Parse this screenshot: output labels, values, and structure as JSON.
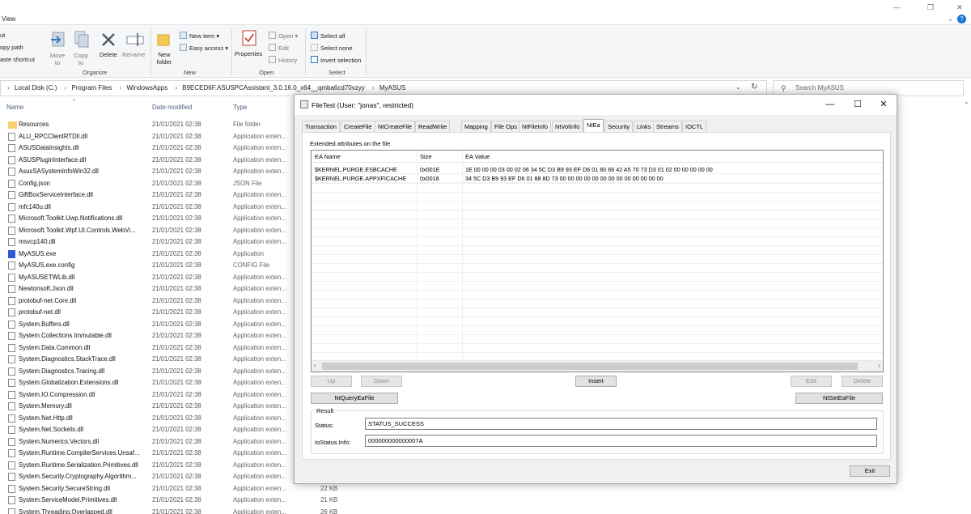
{
  "explorer": {
    "menu_view": "View",
    "ribbon": {
      "cut": "ut",
      "copy_path": "opy path",
      "paste_shortcut": "aste shortcut",
      "move_to": "Move to",
      "copy_to": "Copy to",
      "delete": "Delete",
      "rename": "Rename",
      "new_folder": "New folder",
      "new_item": "New item",
      "easy_access": "Easy access",
      "properties": "Properties",
      "open": "Open",
      "edit": "Edit",
      "history": "History",
      "select_all": "Select all",
      "select_none": "Select none",
      "invert_selection": "Invert selection",
      "groups": {
        "organize": "Organize",
        "new": "New",
        "open": "Open",
        "select": "Select"
      }
    },
    "address": [
      "Local Disk (C:)",
      "Program Files",
      "WindowsApps",
      "B9ECED6F.ASUSPCAssistant_3.0.16.0_x64__qmba6cd70vzyy",
      "MyASUS"
    ],
    "search_placeholder": "Search MyASUS",
    "columns": {
      "name": "Name",
      "date": "Date modified",
      "type": "Type"
    },
    "files": [
      {
        "name": "Resources",
        "date": "21/01/2021 02:38",
        "type": "File folder",
        "icon": "folder"
      },
      {
        "name": "ALU_RPCClientRTDll.dll",
        "date": "21/01/2021 02:38",
        "type": "Application exten...",
        "icon": "file"
      },
      {
        "name": "ASUSDataInsights.dll",
        "date": "21/01/2021 02:38",
        "type": "Application exten...",
        "icon": "file"
      },
      {
        "name": "ASUSPluginInterface.dll",
        "date": "21/01/2021 02:38",
        "type": "Application exten...",
        "icon": "file"
      },
      {
        "name": "AsusSASystemInfoWin32.dll",
        "date": "21/01/2021 02:38",
        "type": "Application exten...",
        "icon": "file"
      },
      {
        "name": "Config.json",
        "date": "21/01/2021 02:38",
        "type": "JSON File",
        "icon": "file"
      },
      {
        "name": "GiftBoxServiceInterface.dll",
        "date": "21/01/2021 02:38",
        "type": "Application exten...",
        "icon": "file"
      },
      {
        "name": "mfc140u.dll",
        "date": "21/01/2021 02:38",
        "type": "Application exten...",
        "icon": "file"
      },
      {
        "name": "Microsoft.Toolkit.Uwp.Notifications.dll",
        "date": "21/01/2021 02:38",
        "type": "Application exten...",
        "icon": "file"
      },
      {
        "name": "Microsoft.Toolkit.Wpf.UI.Controls.WebVi...",
        "date": "21/01/2021 02:38",
        "type": "Application exten...",
        "icon": "file"
      },
      {
        "name": "msvcp140.dll",
        "date": "21/01/2021 02:38",
        "type": "Application exten...",
        "icon": "file"
      },
      {
        "name": "MyASUS.exe",
        "date": "21/01/2021 02:38",
        "type": "Application",
        "icon": "exe"
      },
      {
        "name": "MyASUS.exe.config",
        "date": "21/01/2021 02:38",
        "type": "CONFIG File",
        "icon": "file"
      },
      {
        "name": "MyASUSETWLib.dll",
        "date": "21/01/2021 02:38",
        "type": "Application exten...",
        "icon": "file"
      },
      {
        "name": "Newtonsoft.Json.dll",
        "date": "21/01/2021 02:38",
        "type": "Application exten...",
        "icon": "file"
      },
      {
        "name": "protobuf-net.Core.dll",
        "date": "21/01/2021 02:38",
        "type": "Application exten...",
        "icon": "file"
      },
      {
        "name": "protobuf-net.dll",
        "date": "21/01/2021 02:38",
        "type": "Application exten...",
        "icon": "file"
      },
      {
        "name": "System.Buffers.dll",
        "date": "21/01/2021 02:38",
        "type": "Application exten...",
        "icon": "file"
      },
      {
        "name": "System.Collections.Immutable.dll",
        "date": "21/01/2021 02:38",
        "type": "Application exten...",
        "icon": "file"
      },
      {
        "name": "System.Data.Common.dll",
        "date": "21/01/2021 02:38",
        "type": "Application exten...",
        "icon": "file"
      },
      {
        "name": "System.Diagnostics.StackTrace.dll",
        "date": "21/01/2021 02:38",
        "type": "Application exten...",
        "icon": "file"
      },
      {
        "name": "System.Diagnostics.Tracing.dll",
        "date": "21/01/2021 02:38",
        "type": "Application exten...",
        "icon": "file"
      },
      {
        "name": "System.Globalization.Extensions.dll",
        "date": "21/01/2021 02:38",
        "type": "Application exten...",
        "icon": "file"
      },
      {
        "name": "System.IO.Compression.dll",
        "date": "21/01/2021 02:38",
        "type": "Application exten...",
        "icon": "file"
      },
      {
        "name": "System.Memory.dll",
        "date": "21/01/2021 02:38",
        "type": "Application exten...",
        "icon": "file"
      },
      {
        "name": "System.Net.Http.dll",
        "date": "21/01/2021 02:38",
        "type": "Application exten...",
        "icon": "file"
      },
      {
        "name": "System.Net.Sockets.dll",
        "date": "21/01/2021 02:38",
        "type": "Application exten...",
        "icon": "file"
      },
      {
        "name": "System.Numerics.Vectors.dll",
        "date": "21/01/2021 02:38",
        "type": "Application exten...",
        "icon": "file"
      },
      {
        "name": "System.Runtime.CompilerServices.Unsaf...",
        "date": "21/01/2021 02:38",
        "type": "Application exten...",
        "icon": "file"
      },
      {
        "name": "System.Runtime.Serialization.Primitives.dll",
        "date": "21/01/2021 02:38",
        "type": "Application exten...",
        "icon": "file"
      },
      {
        "name": "System.Security.Cryptography.Algorithm...",
        "date": "21/01/2021 02:38",
        "type": "Application exten...",
        "icon": "file"
      },
      {
        "name": "System.Security.SecureString.dll",
        "date": "21/01/2021 02:38",
        "type": "Application exten...",
        "icon": "file",
        "size": "22 KB"
      },
      {
        "name": "System.ServiceModel.Primitives.dll",
        "date": "21/01/2021 02:38",
        "type": "Application exten...",
        "icon": "file",
        "size": "21 KB"
      },
      {
        "name": "System.Threading.Overlapped.dll",
        "date": "21/01/2021 02:38",
        "type": "Application exten...",
        "icon": "file",
        "size": "26 KB"
      }
    ]
  },
  "dialog": {
    "title": "FileTest (User: \"jonas\", restricted)",
    "tabs": [
      "Transaction",
      "CreateFile",
      "NtCreateFile",
      "ReadWrite",
      "Mapping",
      "File Ops",
      "NtFileInfo",
      "NtVolInfo",
      "NtEa",
      "Security",
      "Links",
      "Streams",
      "IOCTL"
    ],
    "active_tab": "NtEa",
    "section_label": "Extended attributes on the file",
    "list_columns": [
      "EA Name",
      "Size",
      "EA Value"
    ],
    "ea_rows": [
      {
        "name": "$KERNEL.PURGE.ESBCACHE",
        "size": "0x001E",
        "value": "1E 00 00 00 03 00 02 06 34 5C D3 B9 93 EF D6 01 80 66 42 A5 70 73 D3 01 02 00 00 00 00 00"
      },
      {
        "name": "$KERNEL.PURGE.APPXFICACHE",
        "size": "0x0018",
        "value": "34 5C D3 B9 93 EF D6 01 88 8D 73 00 00 00 00 00 00 00 00 00 00 00 00 00"
      }
    ],
    "buttons": {
      "up": "Up",
      "down": "Down",
      "insert": "Insert",
      "edit": "Edit",
      "delete": "Delete",
      "query": "NtQueryEaFile",
      "set": "NtSetEaFile",
      "exit": "Exit"
    },
    "result": {
      "label": "Result",
      "status_label": "Status:",
      "status_value": "STATUS_SUCCESS",
      "iostatus_label": "IoStatus.Info:",
      "iostatus_value": "000000000000007A"
    }
  }
}
